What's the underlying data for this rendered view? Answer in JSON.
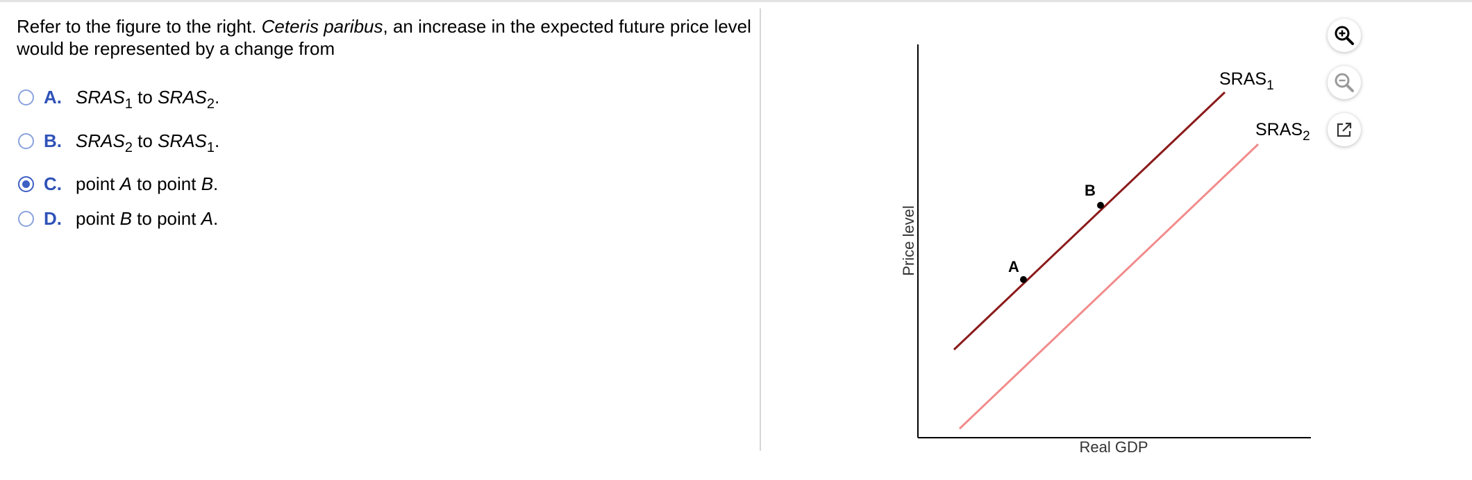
{
  "question": {
    "p1": "Refer to the figure to the right. ",
    "p2": "Ceteris paribus",
    "p3": ", an increase in the expected future price level would be represented by a change from"
  },
  "options": [
    {
      "letter": "A.",
      "t1": "SRAS",
      "s1": "1",
      "mid": " to ",
      "t2": "SRAS",
      "s2": "2",
      "end": ".",
      "selected": false
    },
    {
      "letter": "B.",
      "t1": "SRAS",
      "s1": "2",
      "mid": " to ",
      "t2": "SRAS",
      "s2": "1",
      "end": ".",
      "selected": false
    },
    {
      "letter": "C.",
      "pre": "point ",
      "p1": "A",
      "mid": " to point ",
      "p2": "B",
      "end": ".",
      "selected": true
    },
    {
      "letter": "D.",
      "pre": "point ",
      "p1": "B",
      "mid": " to point ",
      "p2": "A",
      "end": ".",
      "selected": false
    }
  ],
  "figure": {
    "y_axis_label": "Price level",
    "x_axis_label": "Real GDP",
    "sras1_label": "SRAS",
    "sras1_sub": "1",
    "sras2_label": "SRAS",
    "sras2_sub": "2",
    "point_a": "A",
    "point_b": "B",
    "sras1_color": "#8b1a1a",
    "sras2_color": "#f28b8b"
  },
  "tools": {
    "zoom_in": "zoom-in-icon",
    "zoom_out": "zoom-out-icon",
    "popout": "external-link-icon"
  }
}
